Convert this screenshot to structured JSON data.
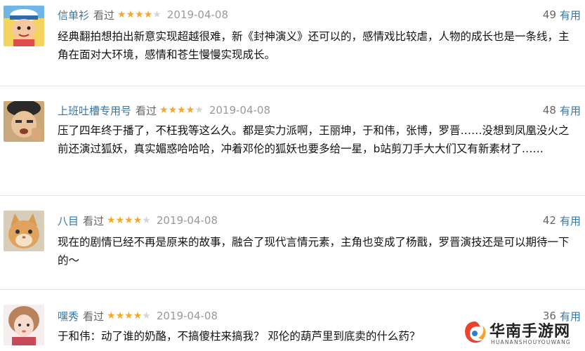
{
  "reviews": [
    {
      "user": "信单衫",
      "status": "看过",
      "rating": 4,
      "date": "2019-04-08",
      "useful_count": "49",
      "useful_label": "有用",
      "text": "经典翻拍想拍出新意实现超越很难，新《封神演义》还可以的，感情戏比较虐，人物的成长也是一条线，主角在面对大环境，感情和苍生慢慢实现成长。",
      "avatar_icon": "cartoon-sailor-avatar-icon"
    },
    {
      "user": "上班吐槽专用号",
      "status": "看过",
      "rating": 4,
      "date": "2019-04-08",
      "useful_count": "48",
      "useful_label": "有用",
      "text": "压了四年终于播了，不枉我等这么久。都是实力派啊，王丽坤，于和伟，张博，罗晋……没想到凤凰没火之前还演过狐妖，真实媚惑哈哈哈，冲着邓伦的狐妖也要多给一星，b站剪刀手大大们又有新素材了……",
      "avatar_icon": "boy-photo-avatar-icon"
    },
    {
      "user": "八目",
      "status": "看过",
      "rating": 4,
      "date": "2019-04-08",
      "useful_count": "42",
      "useful_label": "有用",
      "text": "现在的剧情已经不再是原来的故事，融合了现代言情元素，主角也变成了杨戬，罗晋演技还是可以期待一下的～",
      "avatar_icon": "cat-avatar-icon"
    },
    {
      "user": "嘿秀",
      "status": "看过",
      "rating": 4,
      "date": "2019-04-08",
      "useful_count": "36",
      "useful_label": "有用",
      "text": "于和伟：动了谁的奶酪，不搞傻柱来搞我？ 邓伦的葫芦里到底卖的什么药？",
      "avatar_icon": "girl-avatar-icon"
    }
  ],
  "watermark": {
    "title": "华南手游网",
    "subtitle": "HUANANSHOUYOUWANG"
  },
  "colors": {
    "username": "#3377aa",
    "star_on": "#f3a92c",
    "star_off": "#d6d6d6",
    "date": "#999999",
    "divider": "#e6e6e6"
  }
}
